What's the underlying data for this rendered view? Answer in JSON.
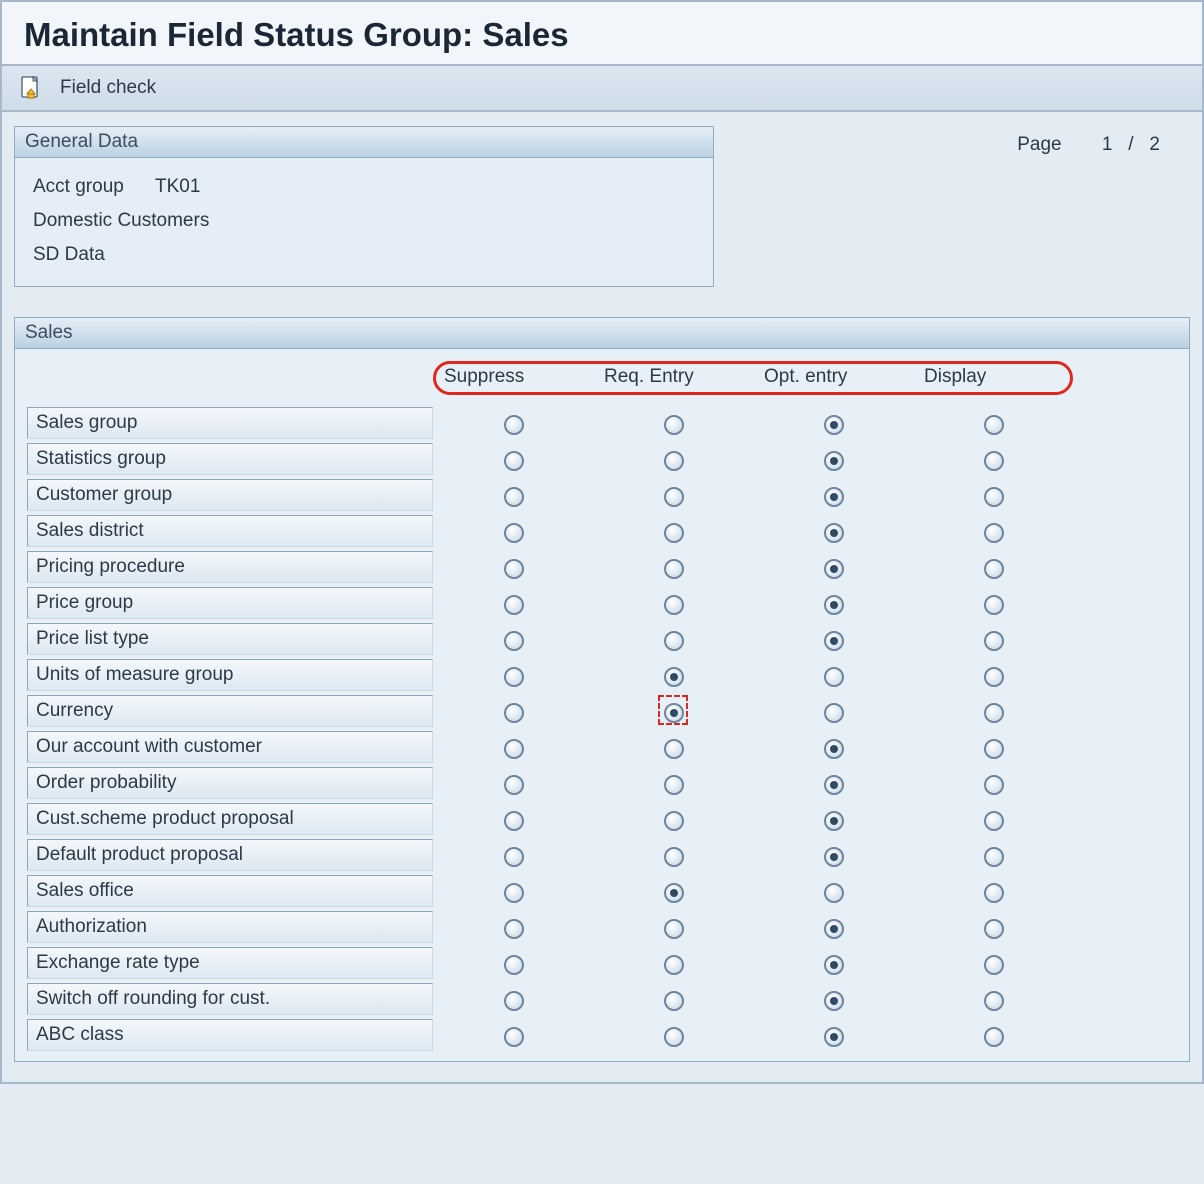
{
  "title": "Maintain Field Status Group: Sales",
  "toolbar": {
    "field_check_label": "Field check"
  },
  "general": {
    "title": "General Data",
    "acct_group_label": "Acct group",
    "acct_group_value": "TK01",
    "desc": "Domestic Customers",
    "area": "SD Data"
  },
  "page": {
    "label": "Page",
    "current": "1",
    "sep": "/",
    "total": "2"
  },
  "sales": {
    "title": "Sales",
    "cols": [
      "Suppress",
      "Req. Entry",
      "Opt. entry",
      "Display"
    ],
    "rows": [
      {
        "label": "Sales group",
        "sel": 2
      },
      {
        "label": "Statistics group",
        "sel": 2
      },
      {
        "label": "Customer group",
        "sel": 2
      },
      {
        "label": "Sales district",
        "sel": 2
      },
      {
        "label": "Pricing procedure",
        "sel": 2
      },
      {
        "label": "Price group",
        "sel": 2
      },
      {
        "label": "Price list type",
        "sel": 2
      },
      {
        "label": "Units of measure group",
        "sel": 1
      },
      {
        "label": "Currency",
        "sel": 1,
        "focus": true
      },
      {
        "label": "Our account with customer",
        "sel": 2
      },
      {
        "label": "Order probability",
        "sel": 2
      },
      {
        "label": "Cust.scheme product proposal",
        "sel": 2
      },
      {
        "label": "Default product proposal",
        "sel": 2
      },
      {
        "label": "Sales office",
        "sel": 1
      },
      {
        "label": "Authorization",
        "sel": 2
      },
      {
        "label": "Exchange rate type",
        "sel": 2
      },
      {
        "label": "Switch off rounding for cust.",
        "sel": 2
      },
      {
        "label": "ABC class",
        "sel": 2
      }
    ]
  }
}
